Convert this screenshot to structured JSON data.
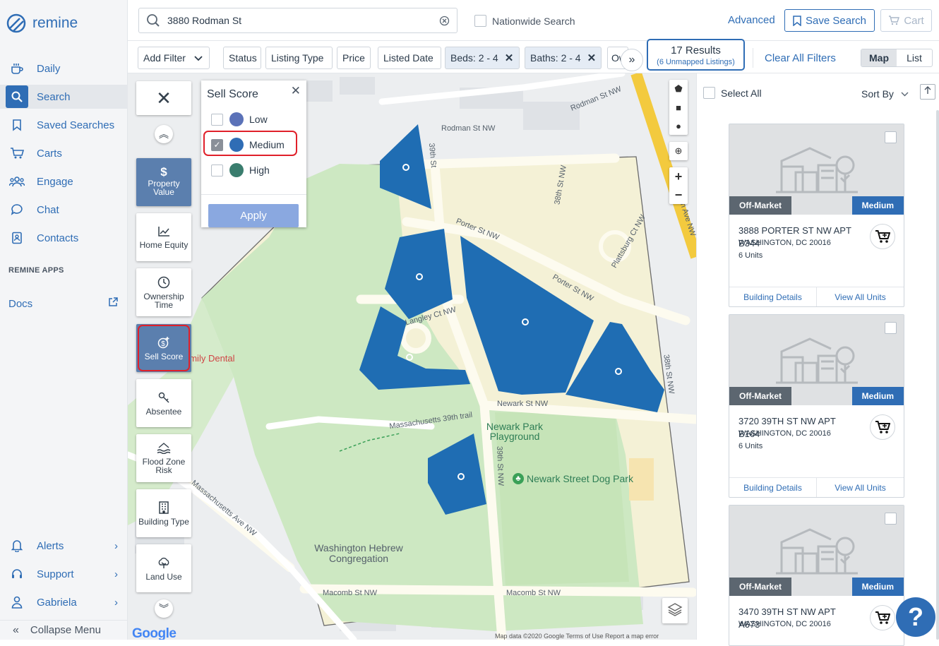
{
  "app": {
    "logo_text": "remine"
  },
  "sidebar": {
    "items": [
      {
        "label": "Daily",
        "icon": "coffee-icon"
      },
      {
        "label": "Search",
        "icon": "search-icon"
      },
      {
        "label": "Saved Searches",
        "icon": "bookmark-icon"
      },
      {
        "label": "Carts",
        "icon": "cart-icon"
      },
      {
        "label": "Engage",
        "icon": "people-icon"
      },
      {
        "label": "Chat",
        "icon": "chat-icon"
      },
      {
        "label": "Contacts",
        "icon": "contacts-icon"
      }
    ],
    "apps_header": "REMINE APPS",
    "docs_label": "Docs",
    "bottom": [
      {
        "label": "Alerts",
        "icon": "bell-icon"
      },
      {
        "label": "Support",
        "icon": "headset-icon"
      },
      {
        "label": "Gabriela",
        "icon": "user-icon"
      }
    ],
    "collapse_label": "Collapse Menu"
  },
  "search": {
    "value": "3880 Rodman St",
    "nationwide_label": "Nationwide Search"
  },
  "header": {
    "advanced": "Advanced",
    "save_search": "Save Search",
    "cart": "Cart"
  },
  "filters": {
    "add_filter": "Add Filter",
    "chips": [
      "Status",
      "Listing Type",
      "Price",
      "Listed Date"
    ],
    "selected": [
      "Beds: 2 - 4",
      "Baths: 2 - 4"
    ],
    "overflow": "Ow",
    "results": "17 Results",
    "unmapped": "(6 Unmapped Listings)",
    "clear": "Clear All Filters",
    "view_map": "Map",
    "view_list": "List"
  },
  "layers": [
    {
      "label": "Property Value",
      "icon": "dollar-icon",
      "active": true
    },
    {
      "label": "Home Equity",
      "icon": "chart-icon",
      "active": false
    },
    {
      "label": "Ownership Time",
      "icon": "clock-icon",
      "active": false
    },
    {
      "label": "Sell Score",
      "icon": "sell-score-icon",
      "active": true
    },
    {
      "label": "Absentee",
      "icon": "key-icon",
      "active": false
    },
    {
      "label": "Flood Zone Risk",
      "icon": "flood-icon",
      "active": false
    },
    {
      "label": "Building Type",
      "icon": "building-icon",
      "active": false
    },
    {
      "label": "Land Use",
      "icon": "tree-icon",
      "active": false
    }
  ],
  "sell_score": {
    "title": "Sell Score",
    "options": [
      {
        "label": "Low",
        "color": "#5b72b8",
        "checked": false
      },
      {
        "label": "Medium",
        "color": "#2f6db5",
        "checked": true
      },
      {
        "label": "High",
        "color": "#3a7d6e",
        "checked": false
      }
    ],
    "apply": "Apply"
  },
  "map": {
    "streets": [
      "Rodman St NW",
      "Rodman St NW",
      "39th St",
      "38th St NW",
      "Porter St NW",
      "Porter St NW",
      "Plattsburg Ct NW",
      "Langley Ct NW",
      "Newark St NW",
      "Massachusetts 39th trail",
      "39th St NW",
      "Macomb St NW",
      "Macomb St NW",
      "Massachusetts Ave NW",
      "Wisconsin Ave NW",
      "38th St NW"
    ],
    "pois": {
      "park": "Newark Park Playground",
      "dog_park": "Newark Street Dog Park",
      "hebrew": "Washington Hebrew Congregation",
      "dental": "amily Dental"
    },
    "attribution": "Map data ©2020 Google   Terms of Use   Report a map error",
    "google": "Google"
  },
  "list": {
    "select_all": "Select All",
    "sort_by": "Sort By",
    "cards": [
      {
        "status": "Off-Market",
        "score": "Medium",
        "address": "3888 PORTER ST NW APT B344",
        "city": "WASHINGTON, DC 20016",
        "units": "6 Units",
        "link1": "Building Details",
        "link2": "View All Units"
      },
      {
        "status": "Off-Market",
        "score": "Medium",
        "address": "3720 39TH ST NW APT B164",
        "city": "WASHINGTON, DC 20016",
        "units": "6 Units",
        "link1": "Building Details",
        "link2": "View All Units"
      },
      {
        "status": "Off-Market",
        "score": "Medium",
        "address": "3470 39TH ST NW APT A673",
        "city": "WASHINGTON, DC 20016",
        "units": "",
        "link1": "",
        "link2": ""
      }
    ]
  },
  "help": "?"
}
